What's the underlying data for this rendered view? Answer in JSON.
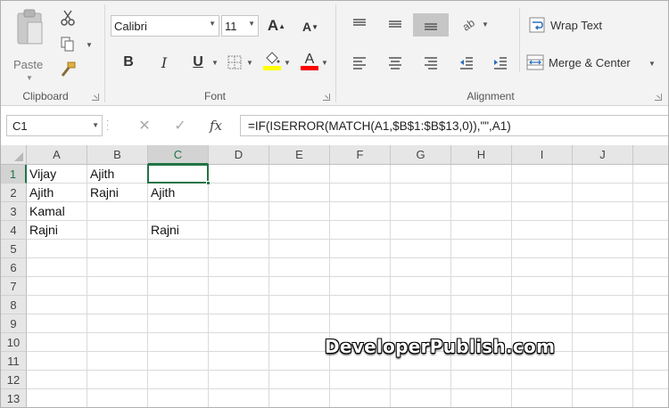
{
  "ribbon": {
    "clipboard": {
      "group_label": "Clipboard",
      "paste_label": "Paste"
    },
    "font": {
      "group_label": "Font",
      "font_name": "Calibri",
      "font_size": "11",
      "bold": "B",
      "italic": "I",
      "underline": "U",
      "grow": "A",
      "shrink": "A",
      "font_color_glyph": "A",
      "fill_color": "#ffff00",
      "font_color": "#ff0000"
    },
    "alignment": {
      "group_label": "Alignment",
      "wrap_text": "Wrap Text",
      "merge_center": "Merge & Center"
    }
  },
  "formula_bar": {
    "name_box": "C1",
    "fx_label": "fx",
    "formula": "=IF(ISERROR(MATCH(A1,$B$1:$B$13,0)),\"\",A1)"
  },
  "grid": {
    "columns": [
      "A",
      "B",
      "C",
      "D",
      "E",
      "F",
      "G",
      "H",
      "I",
      "J"
    ],
    "rows": [
      "1",
      "2",
      "3",
      "4",
      "5",
      "6",
      "7",
      "8",
      "9",
      "10",
      "11",
      "12",
      "13"
    ],
    "selected_cell": "C1",
    "cells": {
      "A1": "Vijay",
      "B1": "Ajith",
      "C1": "",
      "A2": "Ajith",
      "B2": "Rajni",
      "C2": "Ajith",
      "A3": "Kamal",
      "A4": "Rajni",
      "C4": "Rajni"
    }
  },
  "watermark": "DeveloperPublish.com",
  "colors": {
    "accent": "#217346"
  }
}
